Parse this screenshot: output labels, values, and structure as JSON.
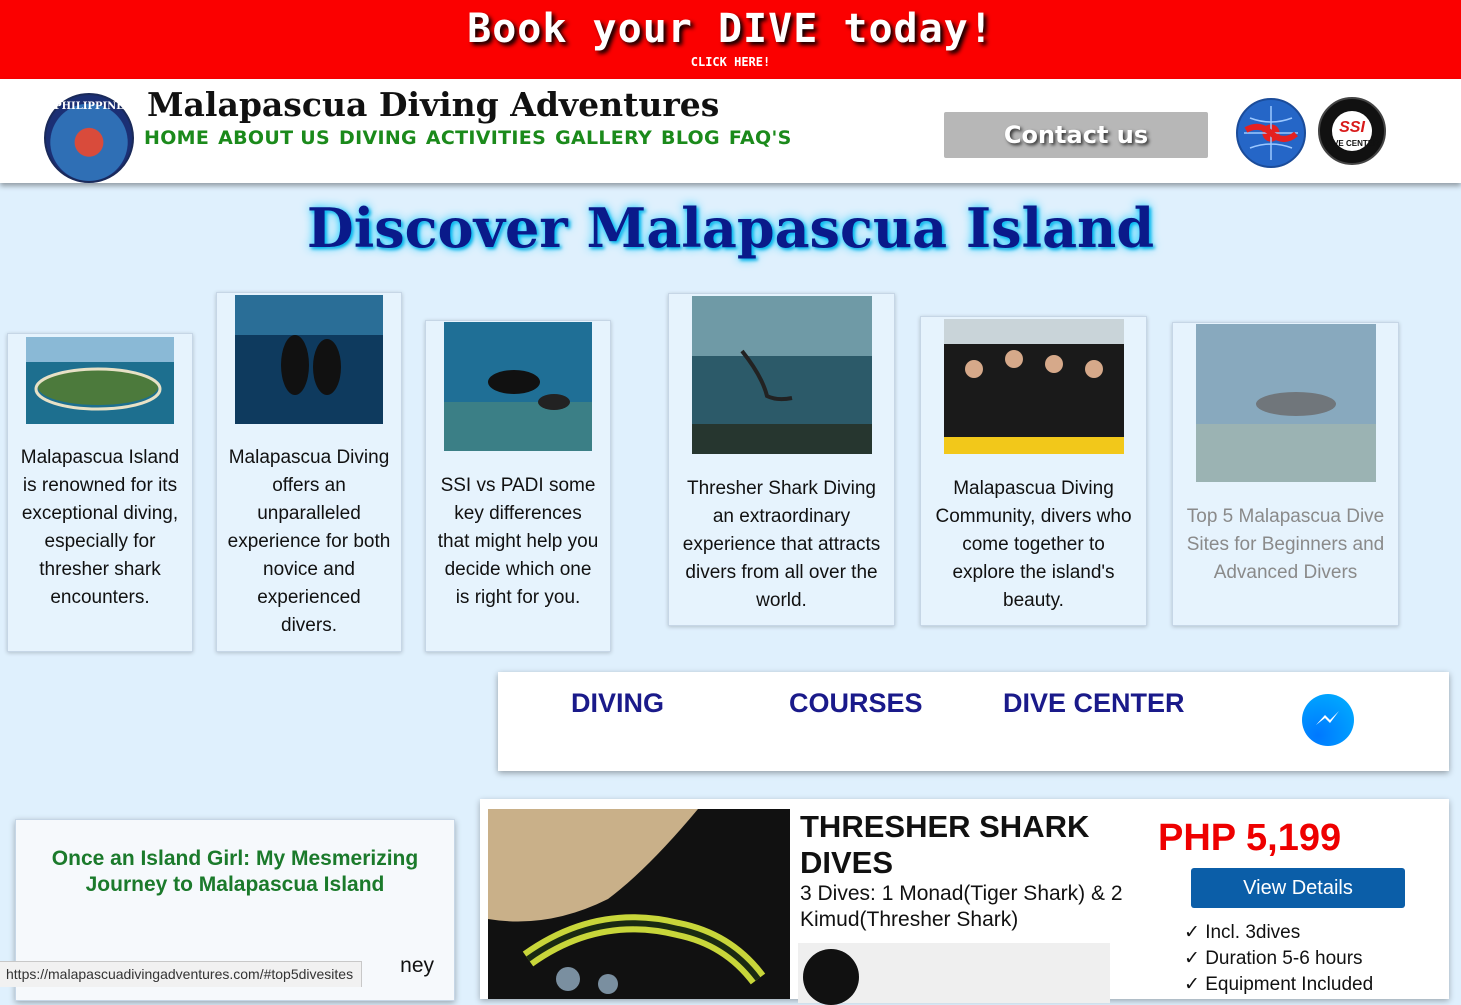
{
  "banner": {
    "title": "Book your DIVE today!",
    "subtitle": "CLICK HERE!"
  },
  "header": {
    "site_title": "Malapascua Diving Adventures",
    "logo_text": "PHILIPPINE",
    "nav": [
      "HOME",
      "ABOUT US",
      "DIVING",
      "ACTIVITIES",
      "GALLERY",
      "BLOG",
      "FAQ'S"
    ],
    "contact_label": "Contact us",
    "ssi_badge": {
      "brand": "SSI",
      "caption": "DIVE CENTER"
    }
  },
  "main": {
    "heading": "Discover Malapascua Island",
    "cards": [
      {
        "text": "Malapascua Island is renowned for its exceptional diving, especially for thresher shark encounters."
      },
      {
        "text": "Malapascua Diving offers an unparalleled experience for both novice and experienced divers."
      },
      {
        "text": "SSI vs PADI some key differences that might help you decide which one is right for you."
      },
      {
        "text": "Thresher Shark Diving an extraordinary experience that attracts divers from all over the world."
      },
      {
        "text": "Malapascua Diving Community, divers who come together to explore the island's beauty."
      },
      {
        "text": "Top 5 Malapascua Dive Sites for Beginners and Advanced Divers"
      }
    ],
    "categories": [
      "DIVING",
      "COURSES",
      "DIVE CENTER"
    ]
  },
  "blog": {
    "title": "Once an Island Girl: My Mesmerizing Journey to Malapascua Island",
    "body_fragment": "ney"
  },
  "product": {
    "title": "THRESHER SHARK DIVES",
    "description": "3 Dives: 1 Monad(Tiger Shark) & 2 Kimud(Thresher Shark)",
    "price": "PHP 5,199",
    "button": "View Details",
    "features": [
      "✓ Incl. 3dives",
      "✓ Duration 5-6 hours",
      "✓ Equipment Included"
    ]
  },
  "status_url": "https://malapascuadivingadventures.com/#top5divesites"
}
